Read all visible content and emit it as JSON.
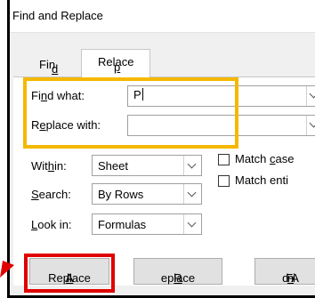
{
  "window": {
    "title": "Find and Replace"
  },
  "tabs": [
    {
      "label": "Find",
      "hotkey": "d",
      "active": false
    },
    {
      "label": "Replace",
      "hotkey": "p",
      "active": true
    }
  ],
  "find_what": {
    "label_pre": "Fi",
    "label_key": "n",
    "label_post": "d what:",
    "value": "P"
  },
  "replace_with": {
    "label_pre": "R",
    "label_key": "e",
    "label_post": "place with:",
    "value": ""
  },
  "options": {
    "within": {
      "label_pre": "Wit",
      "label_key": "h",
      "label_post": "in:",
      "value": "Sheet"
    },
    "search": {
      "label_key": "S",
      "label_post": "earch:",
      "value": "By Rows"
    },
    "look_in": {
      "label_key": "L",
      "label_post": "ook in:",
      "value": "Formulas"
    },
    "match_case": {
      "label_pre": "Match ",
      "label_key": "c",
      "label_post": "ase",
      "checked": false
    },
    "match_entire": {
      "label": "Match enti",
      "checked": false
    }
  },
  "buttons": {
    "replace_all": {
      "label_pre": "Replace ",
      "label_key": "A",
      "label_post": "ll"
    },
    "replace": {
      "label_key": "R",
      "label_post": "eplace"
    },
    "find": {
      "label_pre": "Fi",
      "label_key": "n",
      "label_post": "d A"
    }
  },
  "annotation_colors": {
    "highlight": "#f5b800",
    "callout": "#e00000"
  }
}
